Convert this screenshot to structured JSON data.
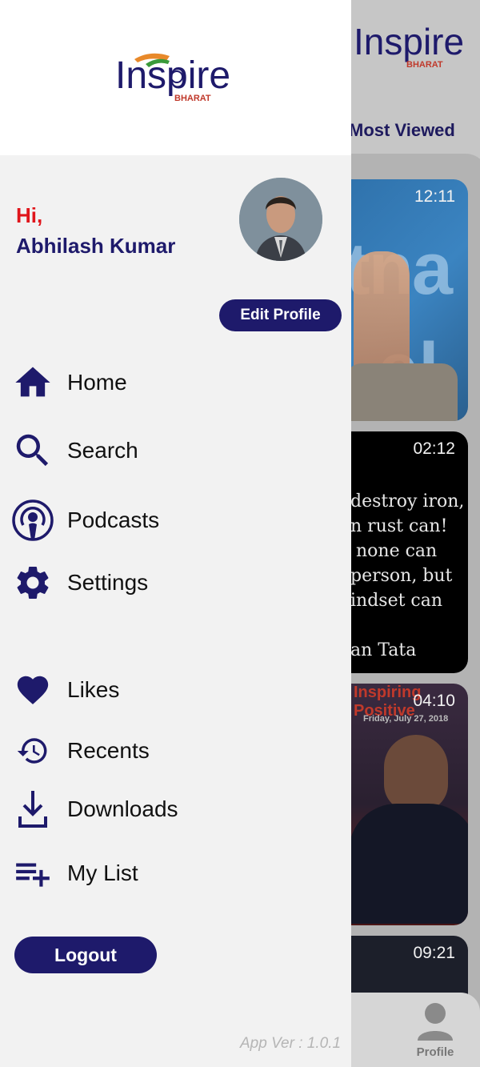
{
  "app": {
    "logo_text": "Inspire",
    "logo_subtext": "BHARAT"
  },
  "background": {
    "tab_label": "Most Viewed",
    "cards": [
      {
        "duration": "12:11"
      },
      {
        "duration": "02:12",
        "quote_lines": [
          "destroy iron,",
          "n rust can!",
          " none can",
          "person, but",
          "indset can",
          "",
          "an Tata"
        ]
      },
      {
        "duration": "04:10",
        "poster_title": "Inspiring",
        "poster_title2": "Positive",
        "poster_date": "Friday, July 27, 2018"
      },
      {
        "duration": "09:21"
      }
    ],
    "bottom_nav": {
      "profile_label": "Profile"
    }
  },
  "drawer": {
    "greeting": "Hi,",
    "user_name": "Abhilash Kumar",
    "edit_profile_label": "Edit Profile",
    "menu": [
      {
        "label": "Home",
        "icon": "home-icon"
      },
      {
        "label": "Search",
        "icon": "search-icon"
      },
      {
        "label": "Podcasts",
        "icon": "podcast-icon"
      },
      {
        "label": "Settings",
        "icon": "gear-icon"
      },
      {
        "label": "Likes",
        "icon": "heart-icon"
      },
      {
        "label": "Recents",
        "icon": "history-icon"
      },
      {
        "label": "Downloads",
        "icon": "download-icon"
      },
      {
        "label": "My List",
        "icon": "playlist-add-icon"
      }
    ],
    "logout_label": "Logout",
    "version": "App Ver : 1.0.1"
  },
  "colors": {
    "brand_navy": "#1e1a6b",
    "greeting_red": "#e0151b",
    "drawer_bg": "#f2f2f2"
  }
}
